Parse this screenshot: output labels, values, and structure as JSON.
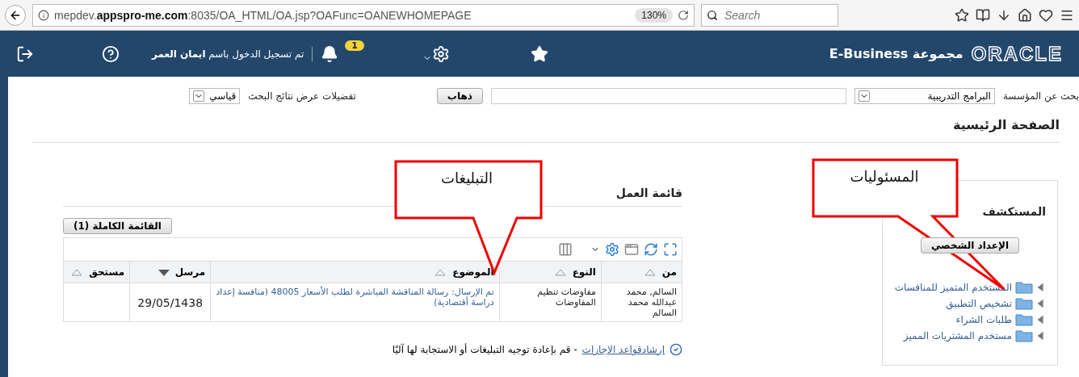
{
  "browser": {
    "url": "mepdev.**appspro-me.com**:8035/OA_HTML/OA.jsp?OAFunc=OANEWHOMEPAGE",
    "zoom": "130%",
    "search": {
      "placeholder": "Search"
    }
  },
  "header": {
    "brand": "ORACLE",
    "product": "E-Business مجموعة",
    "notifications": "1",
    "signed_in": "تم تسجيل الدخول باسم **ايمان العمر**"
  },
  "search_bar": {
    "label": "بحث عن المؤسسة",
    "scope": "البرامج التدريبية",
    "go": "ذهاب",
    "prefs_label": "تفضيلات عرض نتائج البحث",
    "prefs_value": "قياسي"
  },
  "page_title": "الصفحة الرئيسية",
  "navigator": {
    "title": "المستكشف",
    "button": "الإعداد الشخصي",
    "items": [
      {
        "label": "المستخدم المتميز للمنافسات",
        "expanded": false
      },
      {
        "label": "تشخيص التطبيق",
        "expanded": false
      },
      {
        "label": "طلبات الشراء",
        "expanded": false
      },
      {
        "label": "مستخدم المشتريات المميز",
        "expanded": false
      }
    ]
  },
  "worklist": {
    "title": "قائمة العمل",
    "full_list": "القائمة الكاملة (1)",
    "columns": [
      {
        "label": "من",
        "sorted": false
      },
      {
        "label": "النوع",
        "sorted": false
      },
      {
        "label": "الموضوع",
        "sorted": false
      },
      {
        "label": "مرسل",
        "sorted": true
      },
      {
        "label": "مستحق",
        "sorted": false
      }
    ],
    "rows": [
      {
        "from": "السالم, محمد عبدالله محمد السالم",
        "type": "مفاوضات تنظيم المفاوضات",
        "subject": "تم الإرسال: رسالة المناقشة المباشرة لطلب الأسعار 48005 (منافسة إعداد دراسة أقتصادية)",
        "sent": "29/05/1438"
      }
    ],
    "tip_link": "إرشادقواعد الإجازات",
    "tip_text": "- قم بإعادة توجيه التبليغات أو الاستجابة لها آليًا"
  },
  "callouts": [
    {
      "text": "المسئوليات"
    },
    {
      "text": "التبليغات"
    }
  ]
}
